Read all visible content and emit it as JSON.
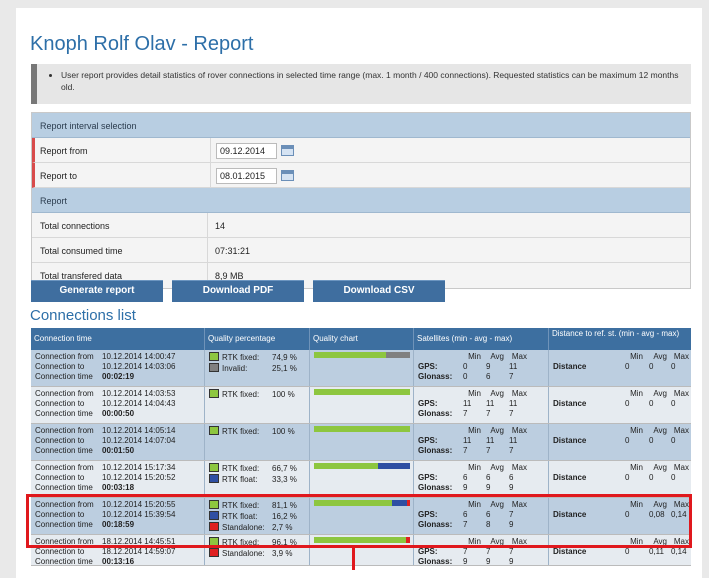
{
  "title": "Knoph Rolf Olav - Report",
  "notice": "User report provides detail statistics of rover connections in selected time range (max. 1 month / 400 connections). Requested statistics can be maximum 12 months old.",
  "interval": {
    "header": "Report interval selection",
    "from_label": "Report from",
    "from_value": "09.12.2014",
    "to_label": "Report to",
    "to_value": "08.01.2015"
  },
  "report": {
    "header": "Report",
    "rows": [
      {
        "label": "Total connections",
        "value": "14"
      },
      {
        "label": "Total consumed time",
        "value": "07:31:21"
      },
      {
        "label": "Total transfered data",
        "value": "8,9 MB"
      }
    ]
  },
  "buttons": {
    "generate": "Generate report",
    "pdf": "Download PDF",
    "csv": "Download CSV"
  },
  "list_title": "Connections list",
  "columns": {
    "time": "Connection time",
    "quality": "Quality percentage",
    "chart": "Quality chart",
    "sats": "Satellites (min - avg - max)",
    "dist": "Distance to ref. st. (min - avg - max)"
  },
  "labels": {
    "from": "Connection from",
    "to": "Connection to",
    "time": "Connection time",
    "min": "Min",
    "avg": "Avg",
    "max": "Max",
    "gps": "GPS:",
    "glonass": "Glonass:",
    "distance": "Distance"
  },
  "colors": {
    "rtk_fixed": "#8dc63f",
    "rtk_float": "#2f4fa3",
    "invalid": "#808080",
    "standalone": "#e02020",
    "highlight": "#e0181d"
  },
  "connections": [
    {
      "from": "10.12.2014 14:00:47",
      "to": "10.12.2014 14:03:06",
      "time": "00:02:19",
      "quality": [
        {
          "label": "RTK fixed:",
          "pct": "74,9 %",
          "color": "#8dc63f"
        },
        {
          "label": "Invalid:",
          "pct": "25,1 %",
          "color": "#808080"
        }
      ],
      "bar": [
        {
          "frac": 0.749,
          "color": "#8dc63f"
        },
        {
          "frac": 0.251,
          "color": "#808080"
        }
      ],
      "gps": [
        "0",
        "9",
        "11"
      ],
      "glonass": [
        "0",
        "6",
        "7"
      ],
      "dist": [
        "0",
        "0",
        "0"
      ]
    },
    {
      "from": "10.12.2014 14:03:53",
      "to": "10.12.2014 14:04:43",
      "time": "00:00:50",
      "quality": [
        {
          "label": "RTK fixed:",
          "pct": "100 %",
          "color": "#8dc63f"
        }
      ],
      "bar": [
        {
          "frac": 1.0,
          "color": "#8dc63f"
        }
      ],
      "gps": [
        "11",
        "11",
        "11"
      ],
      "glonass": [
        "7",
        "7",
        "7"
      ],
      "dist": [
        "0",
        "0",
        "0"
      ]
    },
    {
      "from": "10.12.2014 14:05:14",
      "to": "10.12.2014 14:07:04",
      "time": "00:01:50",
      "quality": [
        {
          "label": "RTK fixed:",
          "pct": "100 %",
          "color": "#8dc63f"
        }
      ],
      "bar": [
        {
          "frac": 1.0,
          "color": "#8dc63f"
        }
      ],
      "gps": [
        "11",
        "11",
        "11"
      ],
      "glonass": [
        "7",
        "7",
        "7"
      ],
      "dist": [
        "0",
        "0",
        "0"
      ]
    },
    {
      "from": "10.12.2014 15:17:34",
      "to": "10.12.2014 15:20:52",
      "time": "00:03:18",
      "quality": [
        {
          "label": "RTK fixed:",
          "pct": "66,7 %",
          "color": "#8dc63f"
        },
        {
          "label": "RTK float:",
          "pct": "33,3 %",
          "color": "#2f4fa3"
        }
      ],
      "bar": [
        {
          "frac": 0.667,
          "color": "#8dc63f"
        },
        {
          "frac": 0.333,
          "color": "#2f4fa3"
        }
      ],
      "gps": [
        "6",
        "6",
        "6"
      ],
      "glonass": [
        "9",
        "9",
        "9"
      ],
      "dist": [
        "0",
        "0",
        "0"
      ]
    },
    {
      "from": "10.12.2014 15:20:55",
      "to": "10.12.2014 15:39:54",
      "time": "00:18:59",
      "quality": [
        {
          "label": "RTK fixed:",
          "pct": "81,1 %",
          "color": "#8dc63f"
        },
        {
          "label": "RTK float:",
          "pct": "16,2 %",
          "color": "#2f4fa3"
        },
        {
          "label": "Standalone:",
          "pct": "2,7 %",
          "color": "#e02020"
        }
      ],
      "bar": [
        {
          "frac": 0.811,
          "color": "#8dc63f"
        },
        {
          "frac": 0.162,
          "color": "#2f4fa3"
        },
        {
          "frac": 0.027,
          "color": "#e02020"
        }
      ],
      "gps": [
        "6",
        "6",
        "7"
      ],
      "glonass": [
        "7",
        "8",
        "9"
      ],
      "dist": [
        "0",
        "0,08",
        "0,14"
      ]
    },
    {
      "from": "18.12.2014 14:45:51",
      "to": "18.12.2014 14:59:07",
      "time": "00:13:16",
      "quality": [
        {
          "label": "RTK fixed:",
          "pct": "96,1 %",
          "color": "#8dc63f"
        },
        {
          "label": "Standalone:",
          "pct": "3,9 %",
          "color": "#e02020"
        }
      ],
      "bar": [
        {
          "frac": 0.961,
          "color": "#8dc63f"
        },
        {
          "frac": 0.039,
          "color": "#e02020"
        }
      ],
      "gps": [
        "7",
        "7",
        "7"
      ],
      "glonass": [
        "9",
        "9",
        "9"
      ],
      "dist": [
        "0",
        "0,11",
        "0,14"
      ]
    }
  ]
}
